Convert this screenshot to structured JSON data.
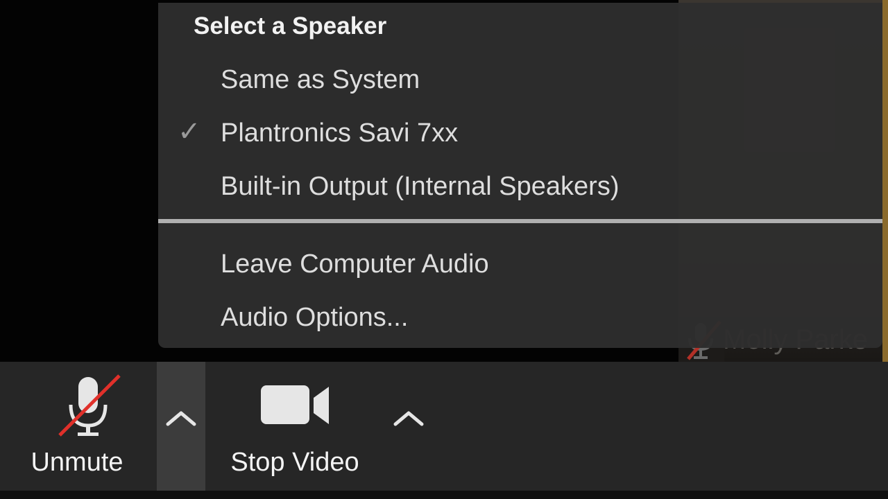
{
  "menu": {
    "header": "Select a Speaker",
    "speakers": [
      {
        "label": "Same as System",
        "checked": false
      },
      {
        "label": "Plantronics Savi 7xx",
        "checked": true
      },
      {
        "label": "Built-in Output (Internal Speakers)",
        "checked": false
      }
    ],
    "actions": [
      {
        "label": "Leave Computer Audio"
      },
      {
        "label": "Audio Options..."
      }
    ],
    "check_glyph": "✓"
  },
  "participant": {
    "name": "Molly Parke"
  },
  "toolbar": {
    "unmute_label": "Unmute",
    "stop_video_label": "Stop Video",
    "audio_menu_open": true
  },
  "colors": {
    "menu_bg": "#2e2e2e",
    "toolbar_bg": "#262626",
    "muted_slash": "#e0302a",
    "text": "#dedede"
  },
  "icons": {
    "unmute": "microphone-muted-icon",
    "audio_caret": "caret-up-icon",
    "video": "video-camera-icon",
    "video_caret": "caret-up-icon",
    "check": "checkmark-icon"
  }
}
